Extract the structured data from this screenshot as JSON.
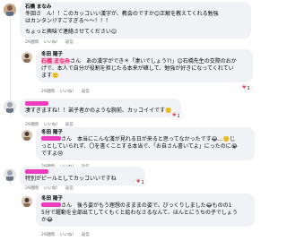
{
  "comments": [
    {
      "author": "石橋 まなみ",
      "text_line1": "冬田さ　ん！！このカッコいい漢字が、教会のですか😊正解を教えてくれる勉強",
      "text_line2": "はカンタン!?すごすぎる～～！！！",
      "text_line3": "ちょっと興味で連絡させてください☺",
      "time": "29週間",
      "actions": [
        "いいね！",
        "返信"
      ]
    },
    {
      "author": "冬田 陽子",
      "mention": "石橋 まなみ",
      "text_line1": "さん　あの漢字ができ＊「凄いでしょう?!」😊石橋先生の交際のおか",
      "text_line2": "げで、本人で自分が役割を担じたる本来が確して、勉強が好きになってくれてい",
      "text_line3": "ます🙂",
      "time": "29週間",
      "actions": [
        "いいね！",
        "返信"
      ],
      "reaction_count": "1"
    },
    {
      "author": "",
      "text_line1": "凄すぎますね！！弟子者かのような腕前、カッコイイです🙂",
      "time": "29週間",
      "actions": [
        "いいね！",
        "返信"
      ],
      "reaction_count": "1"
    },
    {
      "author": "冬田 陽子",
      "mention": "",
      "text_line1": "さん　本当にこんな漢が見れる日が来ると思ってなかったです😂…🙂じ",
      "text_line2": "っとしていられず、〇を書くことする本当で、「お自さん書いてよ」にったのに😭",
      "text_line3": "ですよ😢",
      "time": "29週間",
      "actions": [
        "いいね！",
        "返信"
      ]
    },
    {
      "author": "",
      "text_line1": "特別がピールとしてカッコいいですね",
      "time": "29週間",
      "actions": [
        "いいね！",
        "返信"
      ],
      "reaction_count": "1"
    },
    {
      "author": "冬田 陽子",
      "mention": "",
      "text_line1": "さん　後ろ姿がもう理想のまままの姿で、びっくりしました😂ものの1",
      "text_line2": "5分で躍動を全部出てしてくもくと絵わなさるなんて、ほんとにうちの子でしょう",
      "text_line3": "か😂",
      "time": "29週間",
      "actions": [
        "いいね！",
        "返信"
      ]
    }
  ],
  "colors": {
    "bubble": "#f0f2f5",
    "mention": "#e91e63",
    "meta": "#65676b",
    "heart": "#f33e58"
  }
}
